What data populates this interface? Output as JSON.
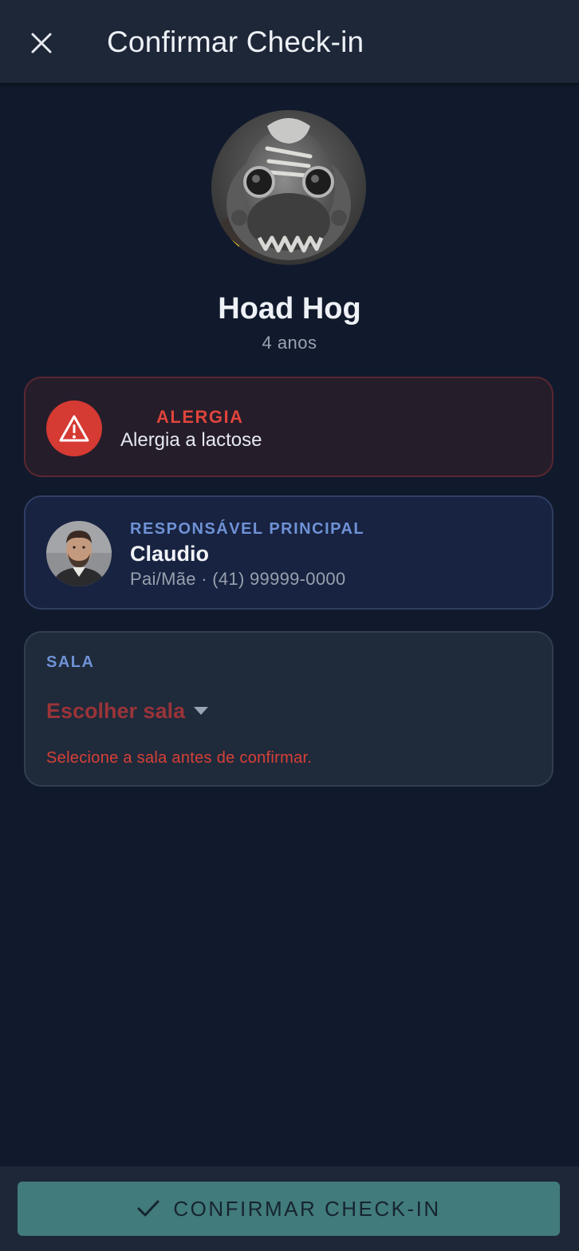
{
  "header": {
    "title": "Confirmar Check-in",
    "close_icon": "close-icon"
  },
  "child": {
    "name": "Hoad Hog",
    "age": "4 anos"
  },
  "allergy": {
    "label": "ALERGIA",
    "text": "Alergia a lactose",
    "icon": "warning-icon",
    "color": "#d53a33"
  },
  "guardian": {
    "label": "RESPONSÁVEL PRINCIPAL",
    "name": "Claudio",
    "info": "Pai/Mãe · (41) 99999-0000"
  },
  "room": {
    "label": "SALA",
    "placeholder": "Escolher sala",
    "error": "Selecione a sala antes de confirmar."
  },
  "footer": {
    "confirm_label": "CONFIRMAR CHECK-IN",
    "confirm_icon": "check-icon",
    "accent": "#417b7b"
  }
}
